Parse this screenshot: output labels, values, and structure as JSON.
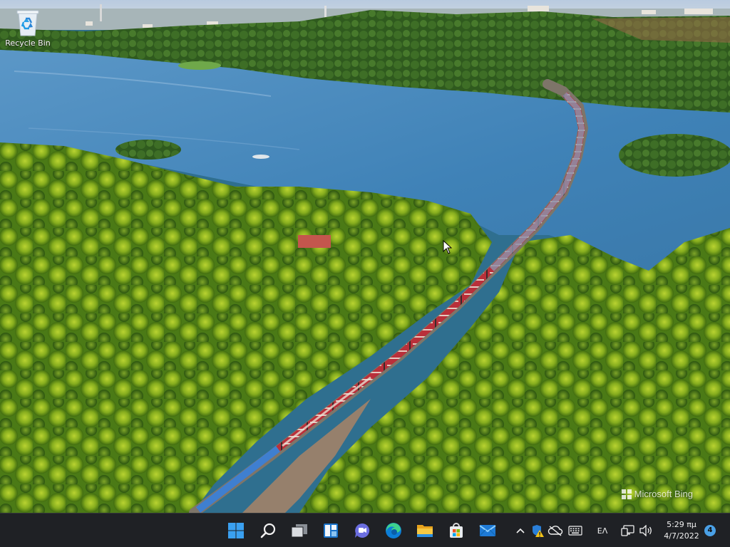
{
  "desktop": {
    "icons": [
      {
        "label": "Recycle Bin",
        "icon": "recycle-bin-icon"
      }
    ],
    "watermark": "Microsoft Bing"
  },
  "taskbar": {
    "apps": [
      {
        "name": "start",
        "icon": "windows-logo-icon"
      },
      {
        "name": "search",
        "icon": "search-icon"
      },
      {
        "name": "task-view",
        "icon": "task-view-icon"
      },
      {
        "name": "widgets",
        "icon": "widgets-icon"
      },
      {
        "name": "chat",
        "icon": "chat-icon"
      },
      {
        "name": "edge",
        "icon": "edge-icon"
      },
      {
        "name": "file-explorer",
        "icon": "folder-icon"
      },
      {
        "name": "store",
        "icon": "store-icon"
      },
      {
        "name": "mail",
        "icon": "mail-icon"
      }
    ],
    "tray": {
      "language": "ΕΛ",
      "time": "5:29 πμ",
      "date": "4/7/2022",
      "notification_count": "4"
    }
  },
  "colors": {
    "taskbar_bg": "#1f2125",
    "windows_blue": "#3aa0f0",
    "accent": "#4aa0e6"
  }
}
